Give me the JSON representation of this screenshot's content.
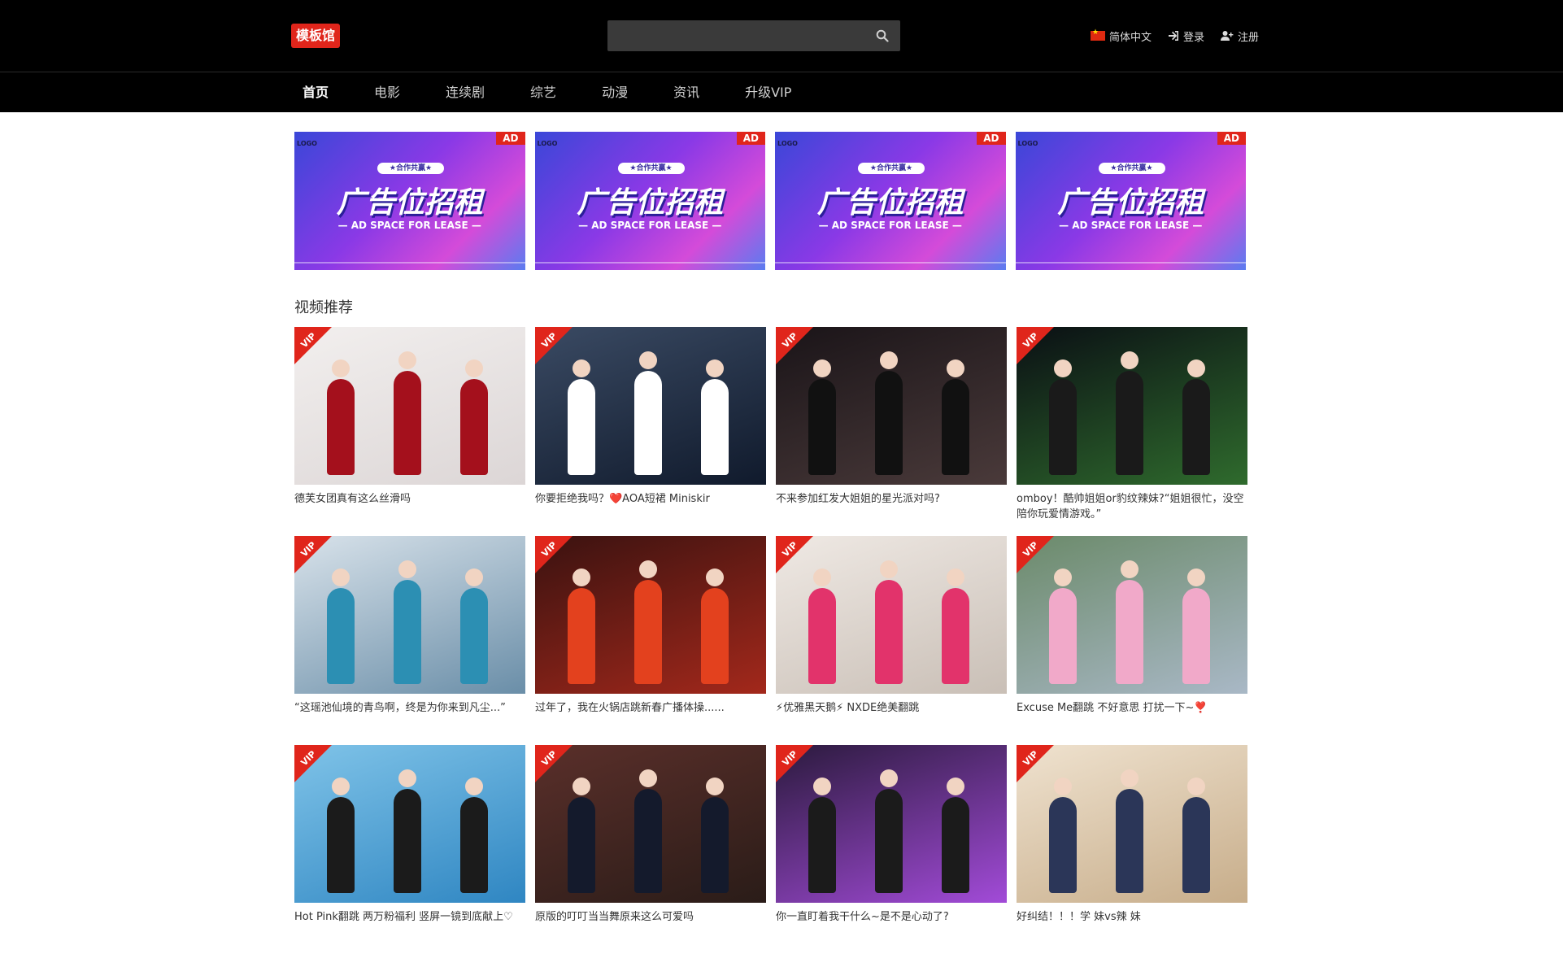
{
  "header": {
    "logo": "模板馆",
    "search": {
      "placeholder": "",
      "value": ""
    },
    "language": "简体中文",
    "login": "登录",
    "register": "注册"
  },
  "nav": {
    "items": [
      "首页",
      "电影",
      "连续剧",
      "综艺",
      "动漫",
      "资讯",
      "升级VIP"
    ],
    "active": "首页"
  },
  "ads": {
    "badge": "AD",
    "logo": "LOGO",
    "ribbon": "★合作共赢★",
    "title": "广告位招租",
    "subtitle": "— AD SPACE FOR LEASE —",
    "count": 4
  },
  "section": {
    "title": "视频推荐"
  },
  "vip_badge": "VIP",
  "videos": [
    {
      "title": "德芙女团真有这么丝滑吗",
      "bg": [
        "#f2efee",
        "#dcd6d6"
      ],
      "outfit": "#a4101c"
    },
    {
      "title": "你要拒绝我吗？❤️AOA短裙 Miniskir",
      "bg": [
        "#3a4a63",
        "#101a2c"
      ],
      "outfit": "#ffffff"
    },
    {
      "title": "不来参加红发大姐姐的星光派对吗?",
      "bg": [
        "#1a1418",
        "#4a3a3a"
      ],
      "outfit": "#111111"
    },
    {
      "title": "omboy！酷帅姐姐or豹纹辣妹?“姐姐很忙，没空陪你玩爱情游戏。”",
      "bg": [
        "#0a0f14",
        "#2f6b2d"
      ],
      "outfit": "#1a1a1a"
    },
    {
      "title": "“这瑶池仙境的青鸟啊，终是为你来到凡尘...”",
      "bg": [
        "#d8e2ea",
        "#6a8ea8"
      ],
      "outfit": "#2c8fb3"
    },
    {
      "title": "过年了，我在火锅店跳新春广播体操......",
      "bg": [
        "#3a1210",
        "#a3281b"
      ],
      "outfit": "#e3411e"
    },
    {
      "title": "⚡优雅黑天鹅⚡ NXDE绝美翻跳",
      "bg": [
        "#efe9e4",
        "#c9bfb6"
      ],
      "outfit": "#e2336b"
    },
    {
      "title": "Excuse Me翻跳 不好意思 打扰一下~❣️",
      "bg": [
        "#6b8a6a",
        "#a9b8c6"
      ],
      "outfit": "#f1a9c9"
    },
    {
      "title": "Hot Pink翻跳 两万粉福利 竖屏一镜到底献上♡",
      "bg": [
        "#7fc3e8",
        "#2f86c2"
      ],
      "outfit": "#1b1b1b"
    },
    {
      "title": "原版的叮叮当当舞原来这么可爱吗",
      "bg": [
        "#5a2f2a",
        "#2a1c18"
      ],
      "outfit": "#141a2c"
    },
    {
      "title": "你一直盯着我干什么~是不是心动了?",
      "bg": [
        "#2b1a3d",
        "#a24bd8"
      ],
      "outfit": "#1b1b1b"
    },
    {
      "title": "好纠结！！！学 妹vs辣 妹",
      "bg": [
        "#efe2cf",
        "#c7ad8a"
      ],
      "outfit": "#2b3658"
    }
  ]
}
